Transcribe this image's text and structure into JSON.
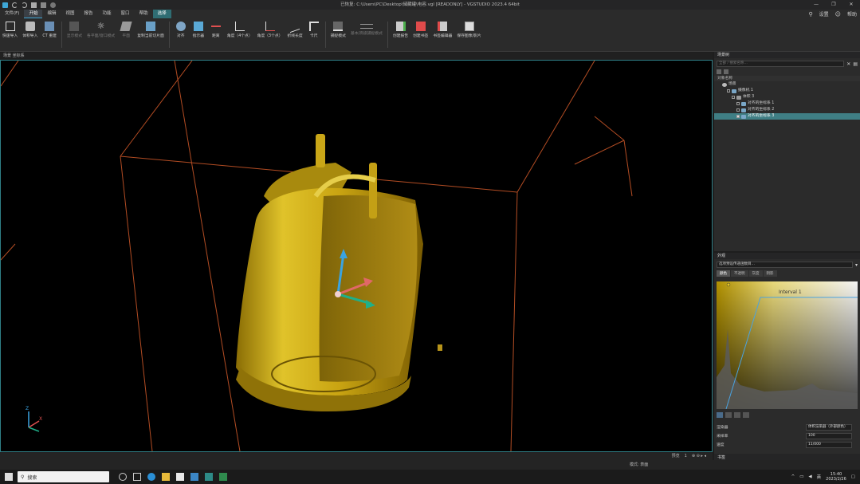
{
  "window": {
    "title": "已恢复: C:\\Users\\PC\\Desktop\\储藏罐\\电容.vgl [READONLY] - VGSTUDIO 2023.4 64bit"
  },
  "menu": {
    "items": [
      "文件(F)",
      "开始",
      "编辑",
      "视图",
      "报告",
      "功能",
      "窗口",
      "帮助",
      "选择"
    ],
    "right_items": [
      "设置",
      "帮助"
    ]
  },
  "ribbon": {
    "buttons": [
      {
        "label": "快速导入",
        "icon": "import-icon"
      },
      {
        "label": "体积导入",
        "icon": "volume-import-icon"
      },
      {
        "label": "CT 重建",
        "icon": "ct-reconstruct-icon"
      },
      {
        "label": "显示模式",
        "icon": "display-mode-icon",
        "dim": true
      },
      {
        "label": "各平面/窗口模式",
        "icon": "light-icon",
        "dim": true
      },
      {
        "label": "平面",
        "icon": "plane-icon",
        "dim": true
      },
      {
        "label": "复制当前切片面",
        "icon": "copy-slice-icon"
      },
      {
        "label": "对齐",
        "icon": "align-icon"
      },
      {
        "label": "指示器",
        "icon": "indicator-icon"
      },
      {
        "label": "距离",
        "icon": "distance-icon"
      },
      {
        "label": "角度（4个点）",
        "icon": "angle4-icon"
      },
      {
        "label": "角度（3个点）",
        "icon": "angle3-icon"
      },
      {
        "label": "折线长度",
        "icon": "polyline-icon"
      },
      {
        "label": "卡尺",
        "icon": "caliper-icon"
      },
      {
        "label": "捕捉模式",
        "icon": "snap-icon"
      },
      {
        "label": "基本/高级捕捉模式",
        "icon": "snap-mode-icon",
        "dim": true
      },
      {
        "label": "创建报告",
        "icon": "report-icon"
      },
      {
        "label": "创建书签",
        "icon": "bookmark-icon"
      },
      {
        "label": "书签编辑器",
        "icon": "bookmark-editor-icon"
      },
      {
        "label": "保存图像/影片",
        "icon": "save-image-icon"
      }
    ]
  },
  "viewport": {
    "header": "场景 坐标系",
    "status_right": [
      "预览",
      "1"
    ]
  },
  "scene_tree": {
    "panel_title": "场景树",
    "search_placeholder": "全部 / 搜索名称…",
    "column_header": "对象名称",
    "nodes": [
      {
        "label": "场景",
        "indent": 0,
        "selected": false
      },
      {
        "label": "摄像机 1",
        "indent": 1,
        "selected": false
      },
      {
        "label": "体积 3",
        "indent": 2,
        "selected": false
      },
      {
        "label": "对齐的坐标系 1",
        "indent": 3,
        "selected": false
      },
      {
        "label": "对齐的坐标系 2",
        "indent": 3,
        "selected": false
      },
      {
        "label": "对齐的坐标系 3",
        "indent": 3,
        "selected": true
      }
    ]
  },
  "transfer": {
    "panel_title": "外观",
    "preset": "选项预设传递函数目…",
    "tabs": [
      "颜色",
      "不透明",
      "灰度",
      "阴影"
    ],
    "interval_label": "Interval 1",
    "rows": [
      {
        "label": "渲染器",
        "value": "体积渲染器（外部颜色）"
      },
      {
        "label": "采样率",
        "value": "100"
      },
      {
        "label": "速度",
        "value": "11/000"
      }
    ]
  },
  "bookmark": {
    "label": "书签"
  },
  "statusbar": {
    "center_text": "模式: 表面"
  },
  "taskbar": {
    "search_label": "搜索",
    "clock_time": "15:40",
    "clock_date": "2023/2/26",
    "lang": "英"
  },
  "colors": {
    "accent": "#3ea6d6",
    "selection": "#3f7e84",
    "object_gold": "#d4b21e"
  }
}
